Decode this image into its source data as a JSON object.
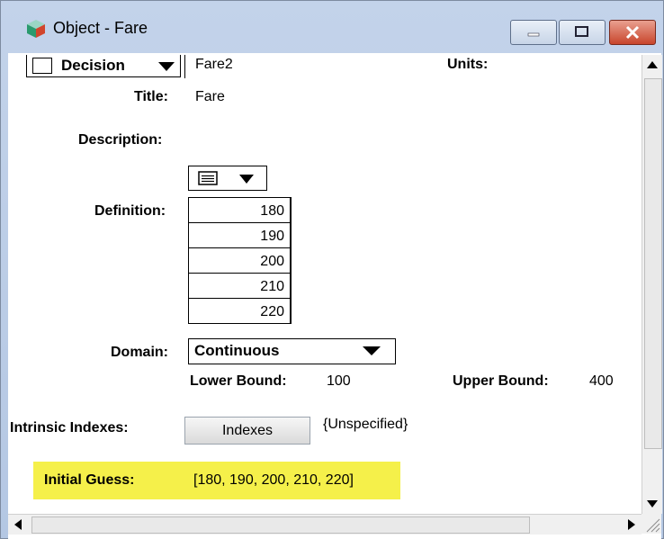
{
  "window": {
    "title": "Object - Fare"
  },
  "header": {
    "class_label": "Decision",
    "identifier": "Fare2",
    "units_label": "Units:",
    "units_value": ""
  },
  "fields": {
    "title_label": "Title:",
    "title_value": "Fare",
    "description_label": "Description:",
    "definition_label": "Definition:",
    "definition_values": [
      "180",
      "190",
      "200",
      "210",
      "220"
    ],
    "domain_label": "Domain:",
    "domain_value": "Continuous",
    "lower_bound_label": "Lower Bound:",
    "lower_bound_value": "100",
    "upper_bound_label": "Upper Bound:",
    "upper_bound_value": "400",
    "intrinsic_label": "Intrinsic Indexes:",
    "indexes_button": "Indexes",
    "intrinsic_value": "{Unspecified}",
    "initial_guess_label": "Initial Guess:",
    "initial_guess_value": "[180, 190, 200, 210, 220]"
  },
  "colors": {
    "highlight": "#f5f04a",
    "close_button": "#c8452c"
  }
}
